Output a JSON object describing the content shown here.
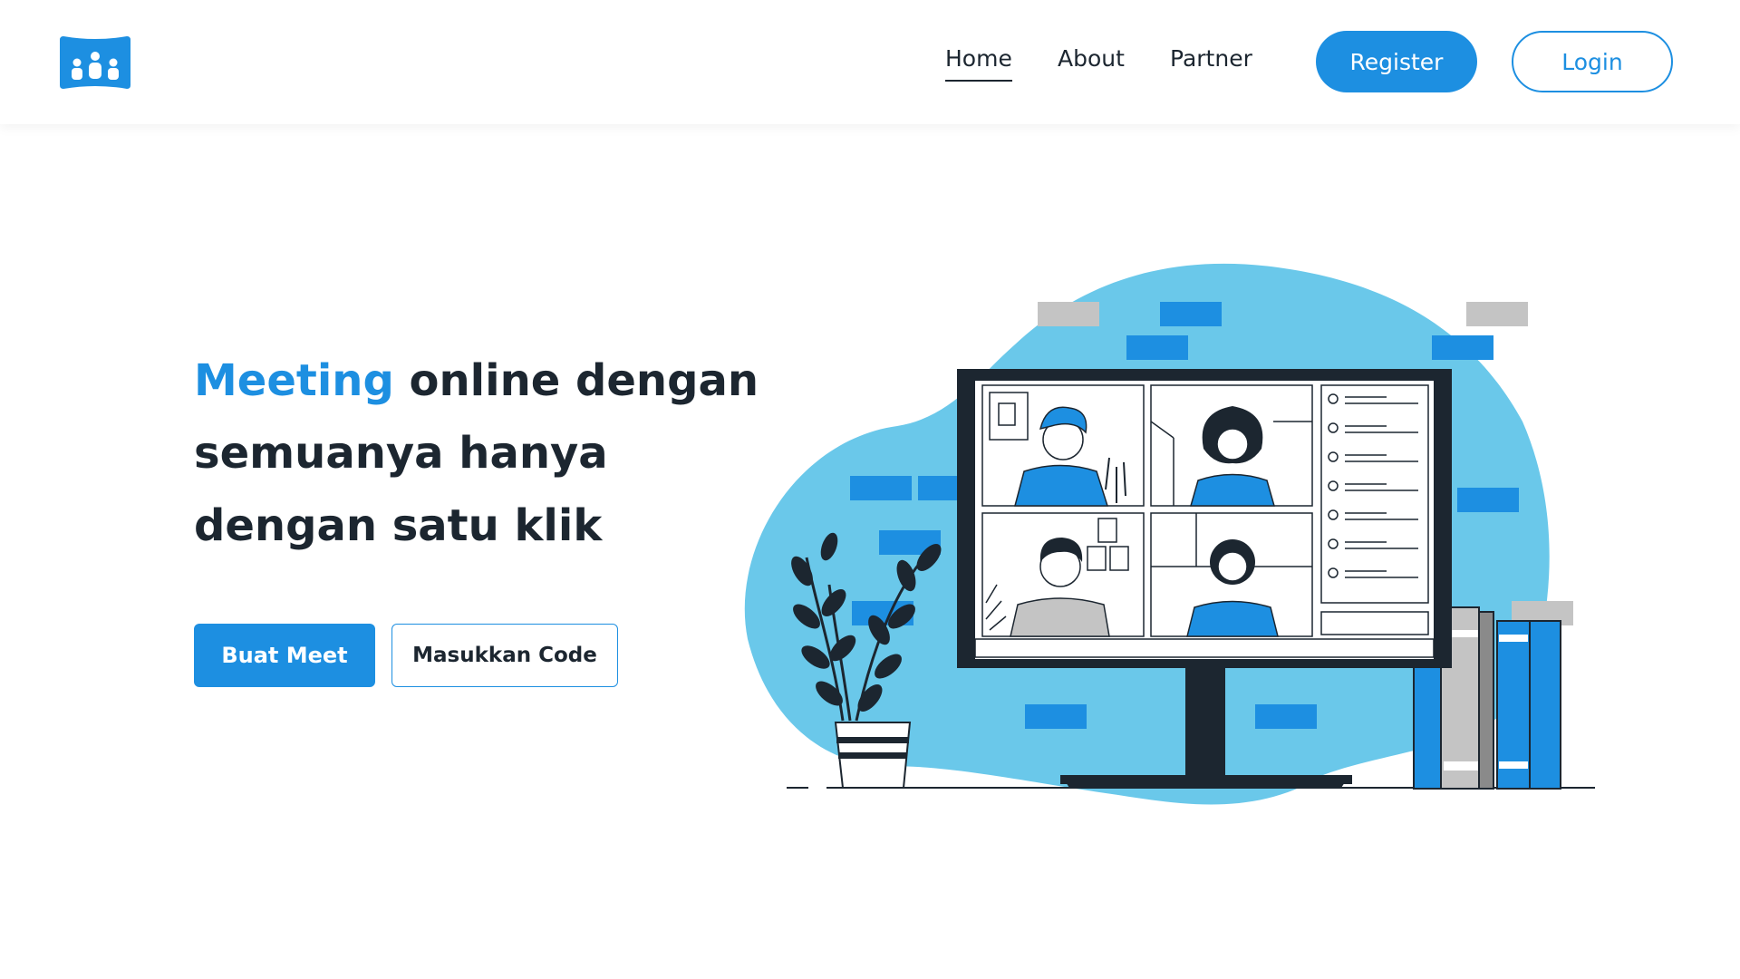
{
  "brand": {
    "logo_icon": "meeting-group-icon",
    "color": "#1d8fe1"
  },
  "nav": {
    "links": [
      {
        "label": "Home",
        "active": true
      },
      {
        "label": "About",
        "active": false
      },
      {
        "label": "Partner",
        "active": false
      }
    ],
    "register_label": "Register",
    "login_label": "Login"
  },
  "hero": {
    "title_accent": "Meeting",
    "title_line1_rest": " online dengan",
    "title_line2": "semuanya hanya",
    "title_line3": "dengan satu klik",
    "primary_button": "Buat Meet",
    "secondary_button": "Masukkan Code"
  },
  "illustration": {
    "subject": "video-conference-illustration",
    "accent_color": "#1d8fe1",
    "blob_color": "#6ac8ea",
    "dark_color": "#1c2630"
  }
}
